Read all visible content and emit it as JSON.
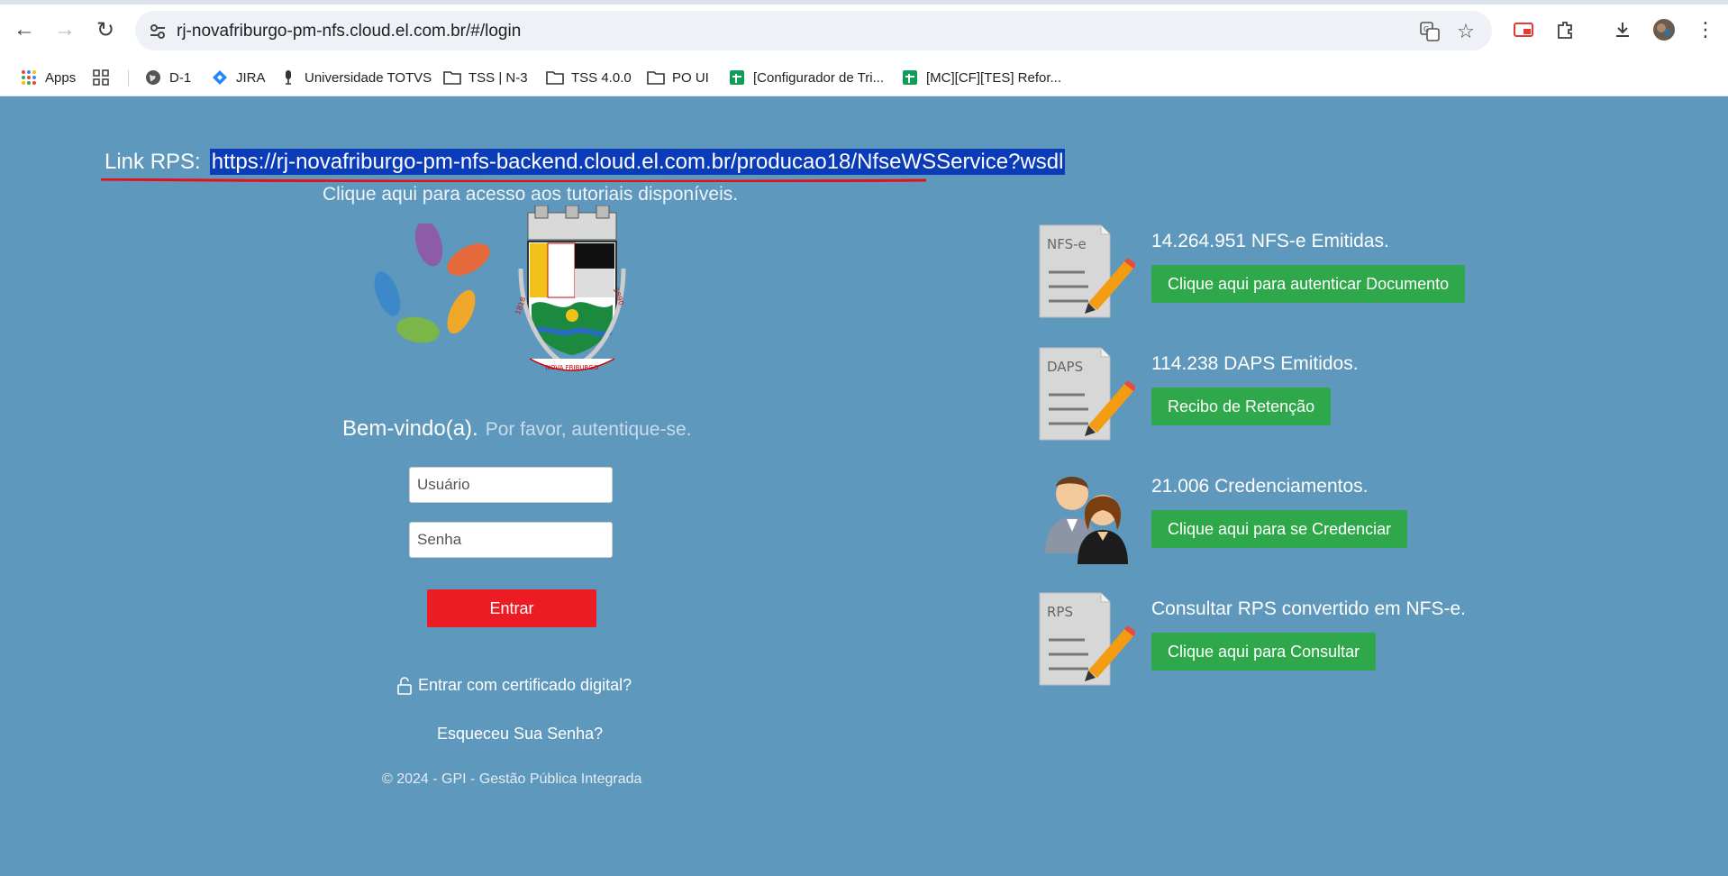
{
  "browser": {
    "url": "rj-novafriburgo-pm-nfs.cloud.el.com.br/#/login",
    "bookmarks": [
      {
        "label": "Apps",
        "icon": "apps-grid-icon"
      },
      {
        "label": "",
        "icon": "grid-icon"
      },
      {
        "label": "D-1",
        "icon": "globe-icon"
      },
      {
        "label": "JIRA",
        "icon": "jira-icon"
      },
      {
        "label": "Universidade TOTVS",
        "icon": "mic-icon"
      },
      {
        "label": "TSS | N-3",
        "icon": "folder-icon"
      },
      {
        "label": "TSS 4.0.0",
        "icon": "folder-icon"
      },
      {
        "label": "PO UI",
        "icon": "folder-icon"
      },
      {
        "label": "[Configurador de Tri...",
        "icon": "sheets-icon"
      },
      {
        "label": "[MC][CF][TES] Refor...",
        "icon": "sheets-icon"
      }
    ]
  },
  "page": {
    "link_rps_label": "Link RPS:",
    "link_rps_url": "https://rj-novafriburgo-pm-nfs-backend.cloud.el.com.br/producao18/NfseWSService?wsdl",
    "tutorial_text": "Clique aqui para acesso aos tutoriais disponíveis.",
    "crest_text": "NOVA FRIBURGO",
    "crest_year_left": "1818",
    "crest_year_right": "1890",
    "welcome": "Bem-vindo(a).",
    "welcome_sub": "Por favor, autentique-se.",
    "user_placeholder": "Usuário",
    "password_placeholder": "Senha",
    "login_button": "Entrar",
    "cert_link": "Entrar com certificado digital?",
    "forgot_link": "Esqueceu Sua Senha?",
    "copyright": "© 2024 - GPI - Gestão Pública Integrada"
  },
  "side": [
    {
      "title": "14.264.951 NFS-e Emitidas.",
      "button": "Clique aqui para autenticar Documento",
      "icon_label": "NFS-e"
    },
    {
      "title": "114.238 DAPS Emitidos.",
      "button": "Recibo de Retenção",
      "icon_label": "DAPS"
    },
    {
      "title": "21.006 Credenciamentos.",
      "button": "Clique aqui para se Credenciar",
      "icon_label": ""
    },
    {
      "title": "Consultar RPS convertido em NFS-e.",
      "button": "Clique aqui para Consultar",
      "icon_label": "RPS"
    }
  ],
  "colors": {
    "background": "#5f98bd",
    "login_button": "#ed1c24",
    "green_button": "#2ea84a",
    "selection": "#0a3bb8",
    "underline": "#e5101c"
  }
}
